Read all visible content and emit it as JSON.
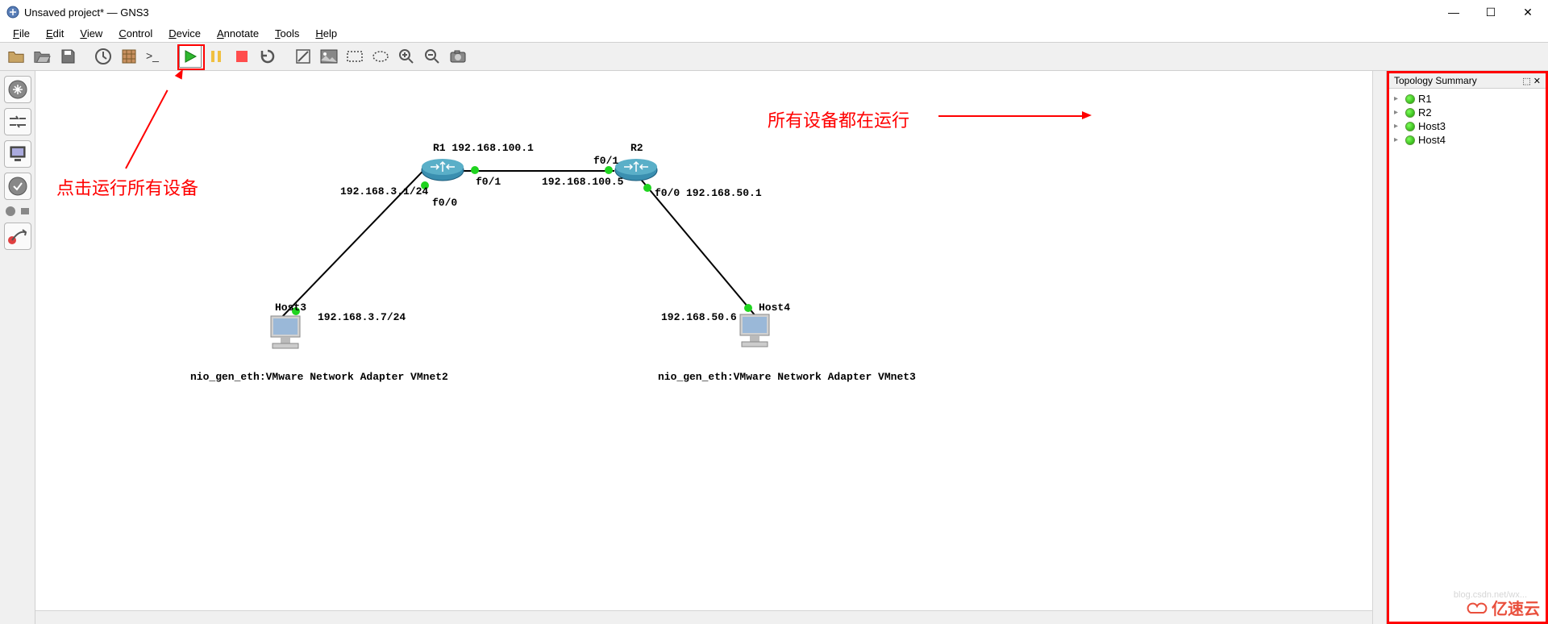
{
  "window": {
    "title": "Unsaved project* — GNS3"
  },
  "menu": {
    "file": "File",
    "edit": "Edit",
    "view": "View",
    "control": "Control",
    "device": "Device",
    "annotate": "Annotate",
    "tools": "Tools",
    "help": "Help"
  },
  "toolbar_icons": {
    "open": "open-folder-icon",
    "open2": "open-project-icon",
    "save": "save-icon",
    "clock": "snapshot-icon",
    "grid": "grid-icon",
    "console": "console-icon",
    "play": "play-icon",
    "pause": "pause-icon",
    "stop": "stop-icon",
    "reload": "reload-icon",
    "note": "note-icon",
    "image": "image-icon",
    "rect": "rectangle-icon",
    "ellipse": "ellipse-icon",
    "zoom_in": "zoom-in-icon",
    "zoom_out": "zoom-out-icon",
    "screenshot": "screenshot-icon"
  },
  "annotations": {
    "click_run": "点击运行所有设备",
    "all_running": "所有设备都在运行"
  },
  "topology_summary": {
    "title": "Topology Summary",
    "items": [
      {
        "name": "R1"
      },
      {
        "name": "R2"
      },
      {
        "name": "Host3"
      },
      {
        "name": "Host4"
      }
    ]
  },
  "nodes": {
    "r1": {
      "label": "R1  192.168.100.1"
    },
    "r2": {
      "label": "R2"
    },
    "host3": {
      "label": "Host3"
    },
    "host4": {
      "label": "Host4"
    },
    "host3_adapter": "nio_gen_eth:VMware Network Adapter VMnet2",
    "host4_adapter": "nio_gen_eth:VMware Network Adapter VMnet3"
  },
  "links": {
    "r1_r2_left_if": "f0/1",
    "r1_r2_right_if": "f0/1",
    "r1_r2_right_ip": "192.168.100.5",
    "r1_h3_if": "f0/0",
    "r1_h3_ip": "192.168.3.1/24",
    "r2_h4_if": "f0/0 192.168.50.1",
    "h3_ip": "192.168.3.7/24",
    "h4_ip": "192.168.50.6"
  },
  "watermark": {
    "text": "亿速云",
    "faded": "blog.csdn.net/wx..."
  }
}
